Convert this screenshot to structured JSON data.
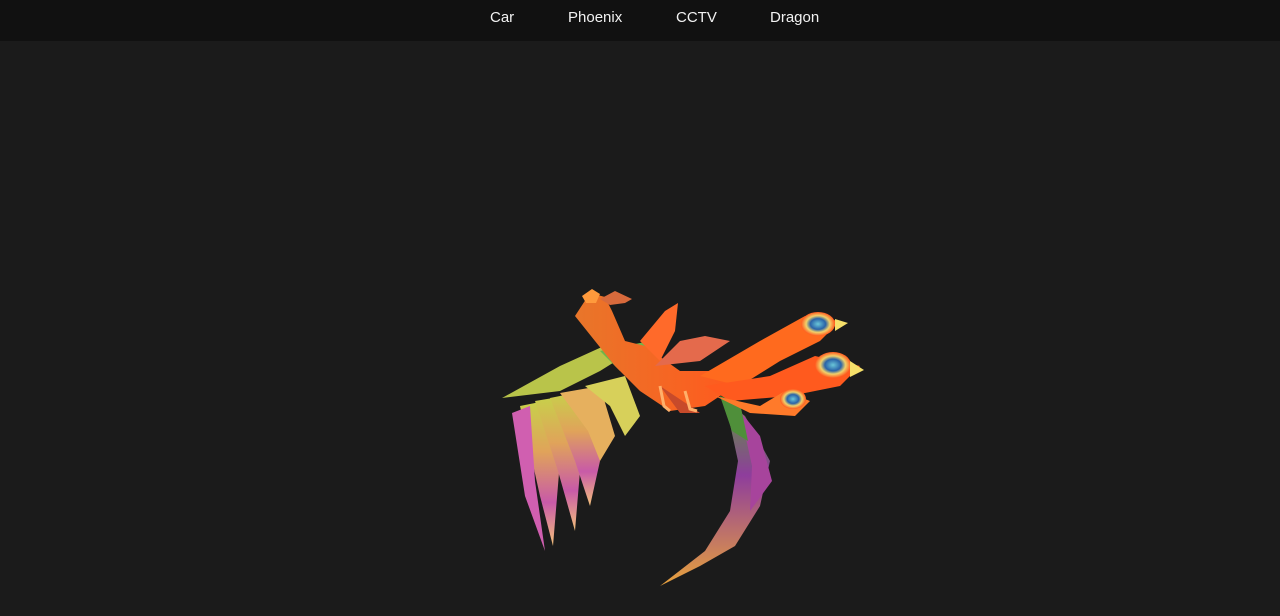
{
  "nav": {
    "items": [
      {
        "label": "Car"
      },
      {
        "label": "Phoenix"
      },
      {
        "label": "CCTV"
      },
      {
        "label": "Dragon"
      }
    ],
    "text_color": "#f2f2f2",
    "background": "#111111"
  },
  "viewer": {
    "background": "#1b1b1b",
    "model": "phoenix-model"
  }
}
